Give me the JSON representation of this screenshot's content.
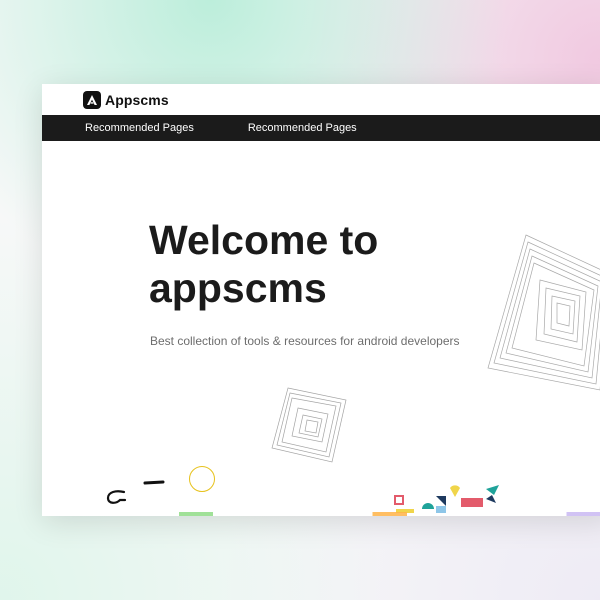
{
  "brand": {
    "name": "Appscms",
    "logo_icon": "appscms-logo-icon"
  },
  "nav": {
    "items": [
      {
        "label": "Recommended Pages"
      },
      {
        "label": "Recommended Pages"
      }
    ]
  },
  "hero": {
    "title": "Welcome to appscms",
    "subtitle": "Best collection of tools & resources for android developers"
  },
  "colors": {
    "navbar_bg": "#1b1b1b",
    "title": "#1b1b1b",
    "subtitle": "#6d6d6d",
    "accent_yellow": "#e7c21c",
    "shape_red": "#e35b6b",
    "shape_teal": "#1fa39a",
    "shape_navy": "#1e3a5f"
  }
}
